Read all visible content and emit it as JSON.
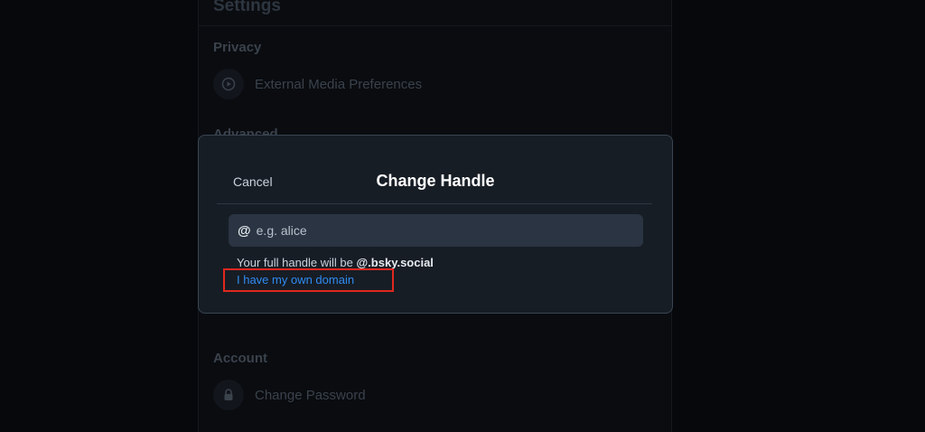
{
  "background": {
    "title": "Settings",
    "sections": [
      {
        "label": "Privacy"
      },
      {
        "label": "Advanced"
      },
      {
        "label": "Account"
      }
    ],
    "rows": [
      {
        "label": "External Media Preferences",
        "icon": "play-circle-icon"
      },
      {
        "label": "Change Password",
        "icon": "lock-icon"
      }
    ]
  },
  "modal": {
    "title": "Change Handle",
    "cancel_label": "Cancel",
    "input": {
      "prefix": "@",
      "placeholder": "e.g. alice",
      "value": ""
    },
    "hint_text": "Your full handle will be ",
    "hint_handle": "@.bsky.social",
    "own_domain_link": "I have my own domain"
  },
  "colors": {
    "accent_link": "#2f8bf2",
    "highlight": "#e0281e",
    "modal_bg": "#171d25"
  }
}
